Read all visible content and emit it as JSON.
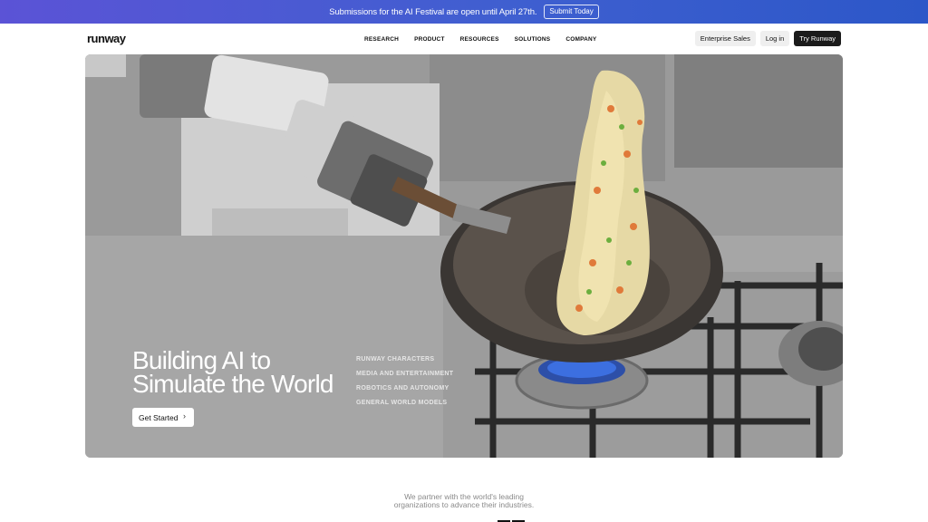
{
  "banner": {
    "text": "Submissions for the AI Festival are open until April 27th.",
    "button": "Submit Today"
  },
  "nav": {
    "logo": "runway",
    "links": [
      "RESEARCH",
      "PRODUCT",
      "RESOURCES",
      "SOLUTIONS",
      "COMPANY"
    ],
    "enterprise": "Enterprise Sales",
    "login": "Log in",
    "try": "Try Runway"
  },
  "hero": {
    "title_line1": "Building AI to",
    "title_line2": "Simulate the World",
    "cta": "Get Started",
    "categories": [
      "RUNWAY CHARACTERS",
      "MEDIA AND ENTERTAINMENT",
      "ROBOTICS AND AUTONOMY",
      "GENERAL WORLD MODELS"
    ]
  },
  "partner": {
    "line1": "We partner with the world's leading",
    "line2": "organizations to advance their industries."
  },
  "colors": {
    "banner_start": "#5b53d6",
    "banner_end": "#2c57c8",
    "try_button": "#1b1b1b"
  }
}
